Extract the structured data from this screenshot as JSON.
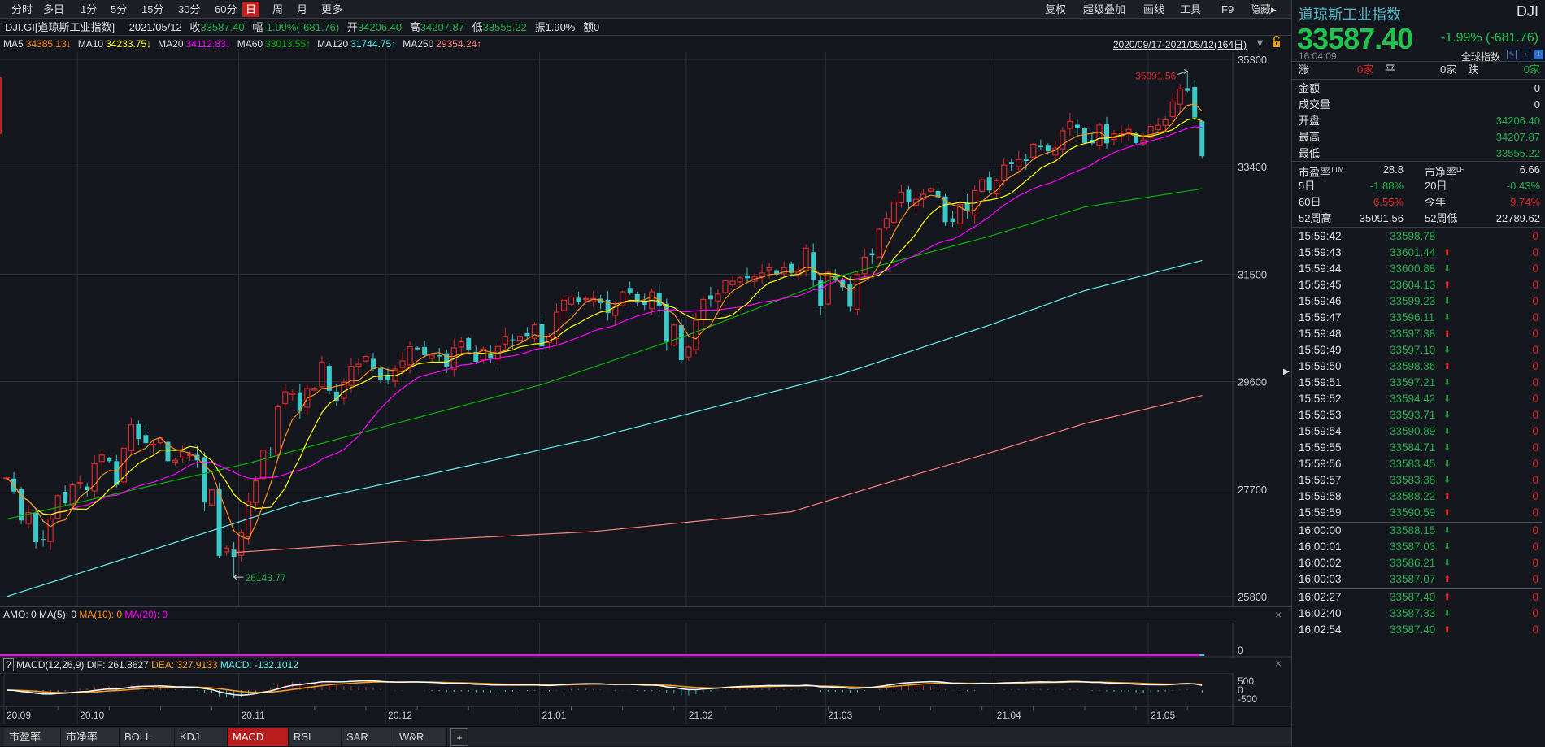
{
  "period_tabs": [
    "分时",
    "多日",
    "1分",
    "5分",
    "15分",
    "30分",
    "60分",
    "日",
    "周",
    "月",
    "更多"
  ],
  "active_period": "日",
  "toolbar": {
    "fuquan": "复权",
    "overlay": "超级叠加",
    "draw": "画线",
    "tools": "工具",
    "f9": "F9",
    "hide": "隐藏"
  },
  "info": {
    "symbol": "DJI.GI[道琼斯工业指数]",
    "date": "2021/05/12",
    "close_label": "收",
    "close": "33587.40",
    "change_label": "幅",
    "change": "-1.99%(-681.76)",
    "open_label": "开",
    "open": "34206.40",
    "high_label": "高",
    "high": "34207.87",
    "low_label": "低",
    "low": "33555.22",
    "amp_label": "振",
    "amp": "1.90%",
    "amount_label": "额",
    "amount": "0"
  },
  "ma_legend": [
    {
      "name": "MA5",
      "value": "34385.13↓",
      "color": "#ff8c1a"
    },
    {
      "name": "MA10",
      "value": "34233.75↓",
      "color": "#ffff00"
    },
    {
      "name": "MA20",
      "value": "34112.83↓",
      "color": "#ff00ff"
    },
    {
      "name": "MA60",
      "value": "33013.55↑",
      "color": "#00b400"
    },
    {
      "name": "MA120",
      "value": "31744.75↑",
      "color": "#5ff0f0"
    },
    {
      "name": "MA250",
      "value": "29354.24↑",
      "color": "#ff7f7f"
    }
  ],
  "date_range": "2020/09/17-2021/05/12(164日)",
  "colors": {
    "up": "#e0262b",
    "down": "#3ac8c8",
    "bg": "#14171d",
    "grid": "#2e3138"
  },
  "chart_data": {
    "type": "candlestick",
    "title": "DJI.GI 日K",
    "price_axis": {
      "ticks": [
        35300,
        33400,
        31500,
        29600,
        27700,
        25800
      ],
      "range": [
        25800,
        35300
      ]
    },
    "month_labels": [
      "20.09",
      "20.10",
      "20.11",
      "20.12",
      "21.01",
      "21.02",
      "21.03",
      "21.04",
      "21.05"
    ],
    "month_start_index": [
      0,
      10,
      32,
      52,
      73,
      93,
      112,
      135,
      156
    ],
    "close": [
      27902,
      27657,
      27147,
      27288,
      26763,
      26815,
      27173,
      27584,
      27452,
      27774,
      27817,
      27682,
      28148,
      28303,
      28195,
      27773,
      28425,
      28837,
      28586,
      28514,
      28494,
      28606,
      28195,
      28211,
      28364,
      28308,
      28210,
      27463,
      27686,
      26520,
      26659,
      26502,
      26925,
      27480,
      27847,
      28390,
      28323,
      29157,
      29420,
      29398,
      29080,
      29479,
      29483,
      29950,
      29438,
      29263,
      29591,
      29872,
      29910,
      30046,
      29823,
      29639,
      29638,
      29823,
      29969,
      30218,
      30173,
      30069,
      30068,
      30046,
      29862,
      30199,
      30303,
      30155,
      29955,
      30179,
      30015,
      30223,
      30404,
      30335,
      30403,
      30409,
      30606,
      30224,
      30391,
      30830,
      31041,
      31097,
      31009,
      31069,
      31068,
      30991,
      30814,
      30930,
      31188,
      31176,
      30997,
      30960,
      31188,
      30937,
      30303,
      30603,
      29982,
      30212,
      30688,
      31055,
      31056,
      31148,
      31386,
      31375,
      31437,
      31430,
      31458,
      31522,
      31613,
      31494,
      31613,
      31522,
      31537,
      31961,
      31402,
      30932,
      31535,
      31391,
      31270,
      30924,
      31496,
      31802,
      31833,
      32297,
      32485,
      32778,
      32953,
      32779,
      32826,
      32913,
      33015,
      32862,
      32420,
      32423,
      32731,
      32619,
      32982,
      33171,
      32981,
      33153,
      33430,
      33446,
      33527,
      33503,
      33800,
      33745,
      33677,
      33730,
      34036,
      34200,
      34078,
      33821,
      33815,
      34137,
      33815,
      33982,
      33981,
      34061,
      33820,
      33875,
      34113,
      34133,
      34230,
      34548,
      34778,
      34743,
      34270,
      33587
    ],
    "last_open": 34206.4,
    "last_high": 34207.87,
    "last_low": 33555.22,
    "period_high": {
      "value": 35091.56,
      "label": "35091.56",
      "index": 161
    },
    "period_low": {
      "value": 26143.77,
      "label": "26143.77",
      "index": 31
    },
    "long_ma_anchors": {
      "MA60": [
        [
          0,
          27170
        ],
        [
          33,
          28160
        ],
        [
          53,
          28860
        ],
        [
          73,
          29550
        ],
        [
          93,
          30430
        ],
        [
          114,
          31480
        ],
        [
          134,
          32170
        ],
        [
          147,
          32690
        ],
        [
          163,
          33013
        ]
      ],
      "MA120": [
        [
          0,
          25800
        ],
        [
          19,
          26590
        ],
        [
          40,
          27470
        ],
        [
          60,
          28030
        ],
        [
          80,
          28600
        ],
        [
          93,
          29035
        ],
        [
          114,
          29740
        ],
        [
          134,
          30600
        ],
        [
          147,
          31210
        ],
        [
          163,
          31744
        ]
      ],
      "MA250": [
        [
          31,
          26580
        ],
        [
          53,
          26770
        ],
        [
          80,
          26950
        ],
        [
          107,
          27300
        ],
        [
          120,
          27810
        ],
        [
          134,
          28340
        ],
        [
          147,
          28860
        ],
        [
          163,
          29354
        ]
      ]
    }
  },
  "volume_panel": {
    "label": "AMO: 0",
    "ma5": "MA(5): 0",
    "ma10": "MA(10): 0",
    "ma20": "MA(20): 0",
    "axis_zero": "0"
  },
  "macd_panel": {
    "help": "?",
    "label": "MACD(12,26,9)",
    "dif": "DIF: 261.8627",
    "dea": "DEA: 327.9133",
    "macd": "MACD: -132.1012",
    "axis": [
      "500",
      "0",
      "-500"
    ],
    "range": [
      -900,
      900
    ]
  },
  "indicator_tabs": [
    "市盈率",
    "市净率",
    "BOLL",
    "KDJ",
    "MACD",
    "RSI",
    "SAR",
    "W&R"
  ],
  "active_indicator": "MACD",
  "right_panel": {
    "name": "道琼斯工业指数",
    "code": "DJI",
    "price": "33587.40",
    "change": "-1.99% (-681.76)",
    "time": "16:04:09",
    "global_index": "全球指数",
    "breadth": {
      "up_label": "涨",
      "up": "0家",
      "flat_label": "平",
      "flat": "0家",
      "down_label": "跌",
      "down": "0家"
    },
    "stats": [
      {
        "label": "金额",
        "value": "0",
        "color": "w"
      },
      {
        "label": "成交量",
        "value": "0",
        "color": "w"
      },
      {
        "label": "开盘",
        "value": "34206.40",
        "color": "g"
      },
      {
        "label": "最高",
        "value": "34207.87",
        "color": "g"
      },
      {
        "label": "最低",
        "value": "33555.22",
        "color": "g"
      }
    ],
    "ratios": [
      {
        "l1": "市盈率",
        "s1": "TTM",
        "v1": "28.8",
        "c1": "w",
        "l2": "市净率",
        "s2": "LF",
        "v2": "6.66",
        "c2": "w"
      },
      {
        "l1": "5日",
        "s1": "",
        "v1": "-1.88%",
        "c1": "g",
        "l2": "20日",
        "s2": "",
        "v2": "-0.43%",
        "c2": "g"
      },
      {
        "l1": "60日",
        "s1": "",
        "v1": "6.55%",
        "c1": "r",
        "l2": "今年",
        "s2": "",
        "v2": "9.74%",
        "c2": "r"
      },
      {
        "l1": "52周高",
        "s1": "",
        "v1": "35091.56",
        "c1": "w",
        "l2": "52周低",
        "s2": "",
        "v2": "22789.62",
        "c2": "w"
      }
    ],
    "ticks": [
      {
        "time": "15:59:42",
        "price": "33598.78",
        "dir": "",
        "vol": "0"
      },
      {
        "time": "15:59:43",
        "price": "33601.44",
        "dir": "up",
        "vol": "0"
      },
      {
        "time": "15:59:44",
        "price": "33600.88",
        "dir": "down",
        "vol": "0"
      },
      {
        "time": "15:59:45",
        "price": "33604.13",
        "dir": "up",
        "vol": "0"
      },
      {
        "time": "15:59:46",
        "price": "33599.23",
        "dir": "down",
        "vol": "0"
      },
      {
        "time": "15:59:47",
        "price": "33596.11",
        "dir": "down",
        "vol": "0"
      },
      {
        "time": "15:59:48",
        "price": "33597.38",
        "dir": "up",
        "vol": "0"
      },
      {
        "time": "15:59:49",
        "price": "33597.10",
        "dir": "down",
        "vol": "0"
      },
      {
        "time": "15:59:50",
        "price": "33598.36",
        "dir": "up",
        "vol": "0"
      },
      {
        "time": "15:59:51",
        "price": "33597.21",
        "dir": "down",
        "vol": "0"
      },
      {
        "time": "15:59:52",
        "price": "33594.42",
        "dir": "down",
        "vol": "0"
      },
      {
        "time": "15:59:53",
        "price": "33593.71",
        "dir": "down",
        "vol": "0"
      },
      {
        "time": "15:59:54",
        "price": "33590.89",
        "dir": "down",
        "vol": "0"
      },
      {
        "time": "15:59:55",
        "price": "33584.71",
        "dir": "down",
        "vol": "0"
      },
      {
        "time": "15:59:56",
        "price": "33583.45",
        "dir": "down",
        "vol": "0"
      },
      {
        "time": "15:59:57",
        "price": "33583.38",
        "dir": "down",
        "vol": "0"
      },
      {
        "time": "15:59:58",
        "price": "33588.22",
        "dir": "up",
        "vol": "0"
      },
      {
        "time": "15:59:59",
        "price": "33590.59",
        "dir": "up",
        "vol": "0"
      },
      {
        "time": "16:00:00",
        "price": "33588.15",
        "dir": "down",
        "vol": "0"
      },
      {
        "time": "16:00:01",
        "price": "33587.03",
        "dir": "down",
        "vol": "0"
      },
      {
        "time": "16:00:02",
        "price": "33586.21",
        "dir": "down",
        "vol": "0"
      },
      {
        "time": "16:00:03",
        "price": "33587.07",
        "dir": "up",
        "vol": "0"
      },
      {
        "time": "16:02:27",
        "price": "33587.40",
        "dir": "up",
        "vol": "0"
      },
      {
        "time": "16:02:40",
        "price": "33587.33",
        "dir": "down",
        "vol": "0"
      },
      {
        "time": "16:02:54",
        "price": "33587.40",
        "dir": "up",
        "vol": "0"
      }
    ]
  }
}
